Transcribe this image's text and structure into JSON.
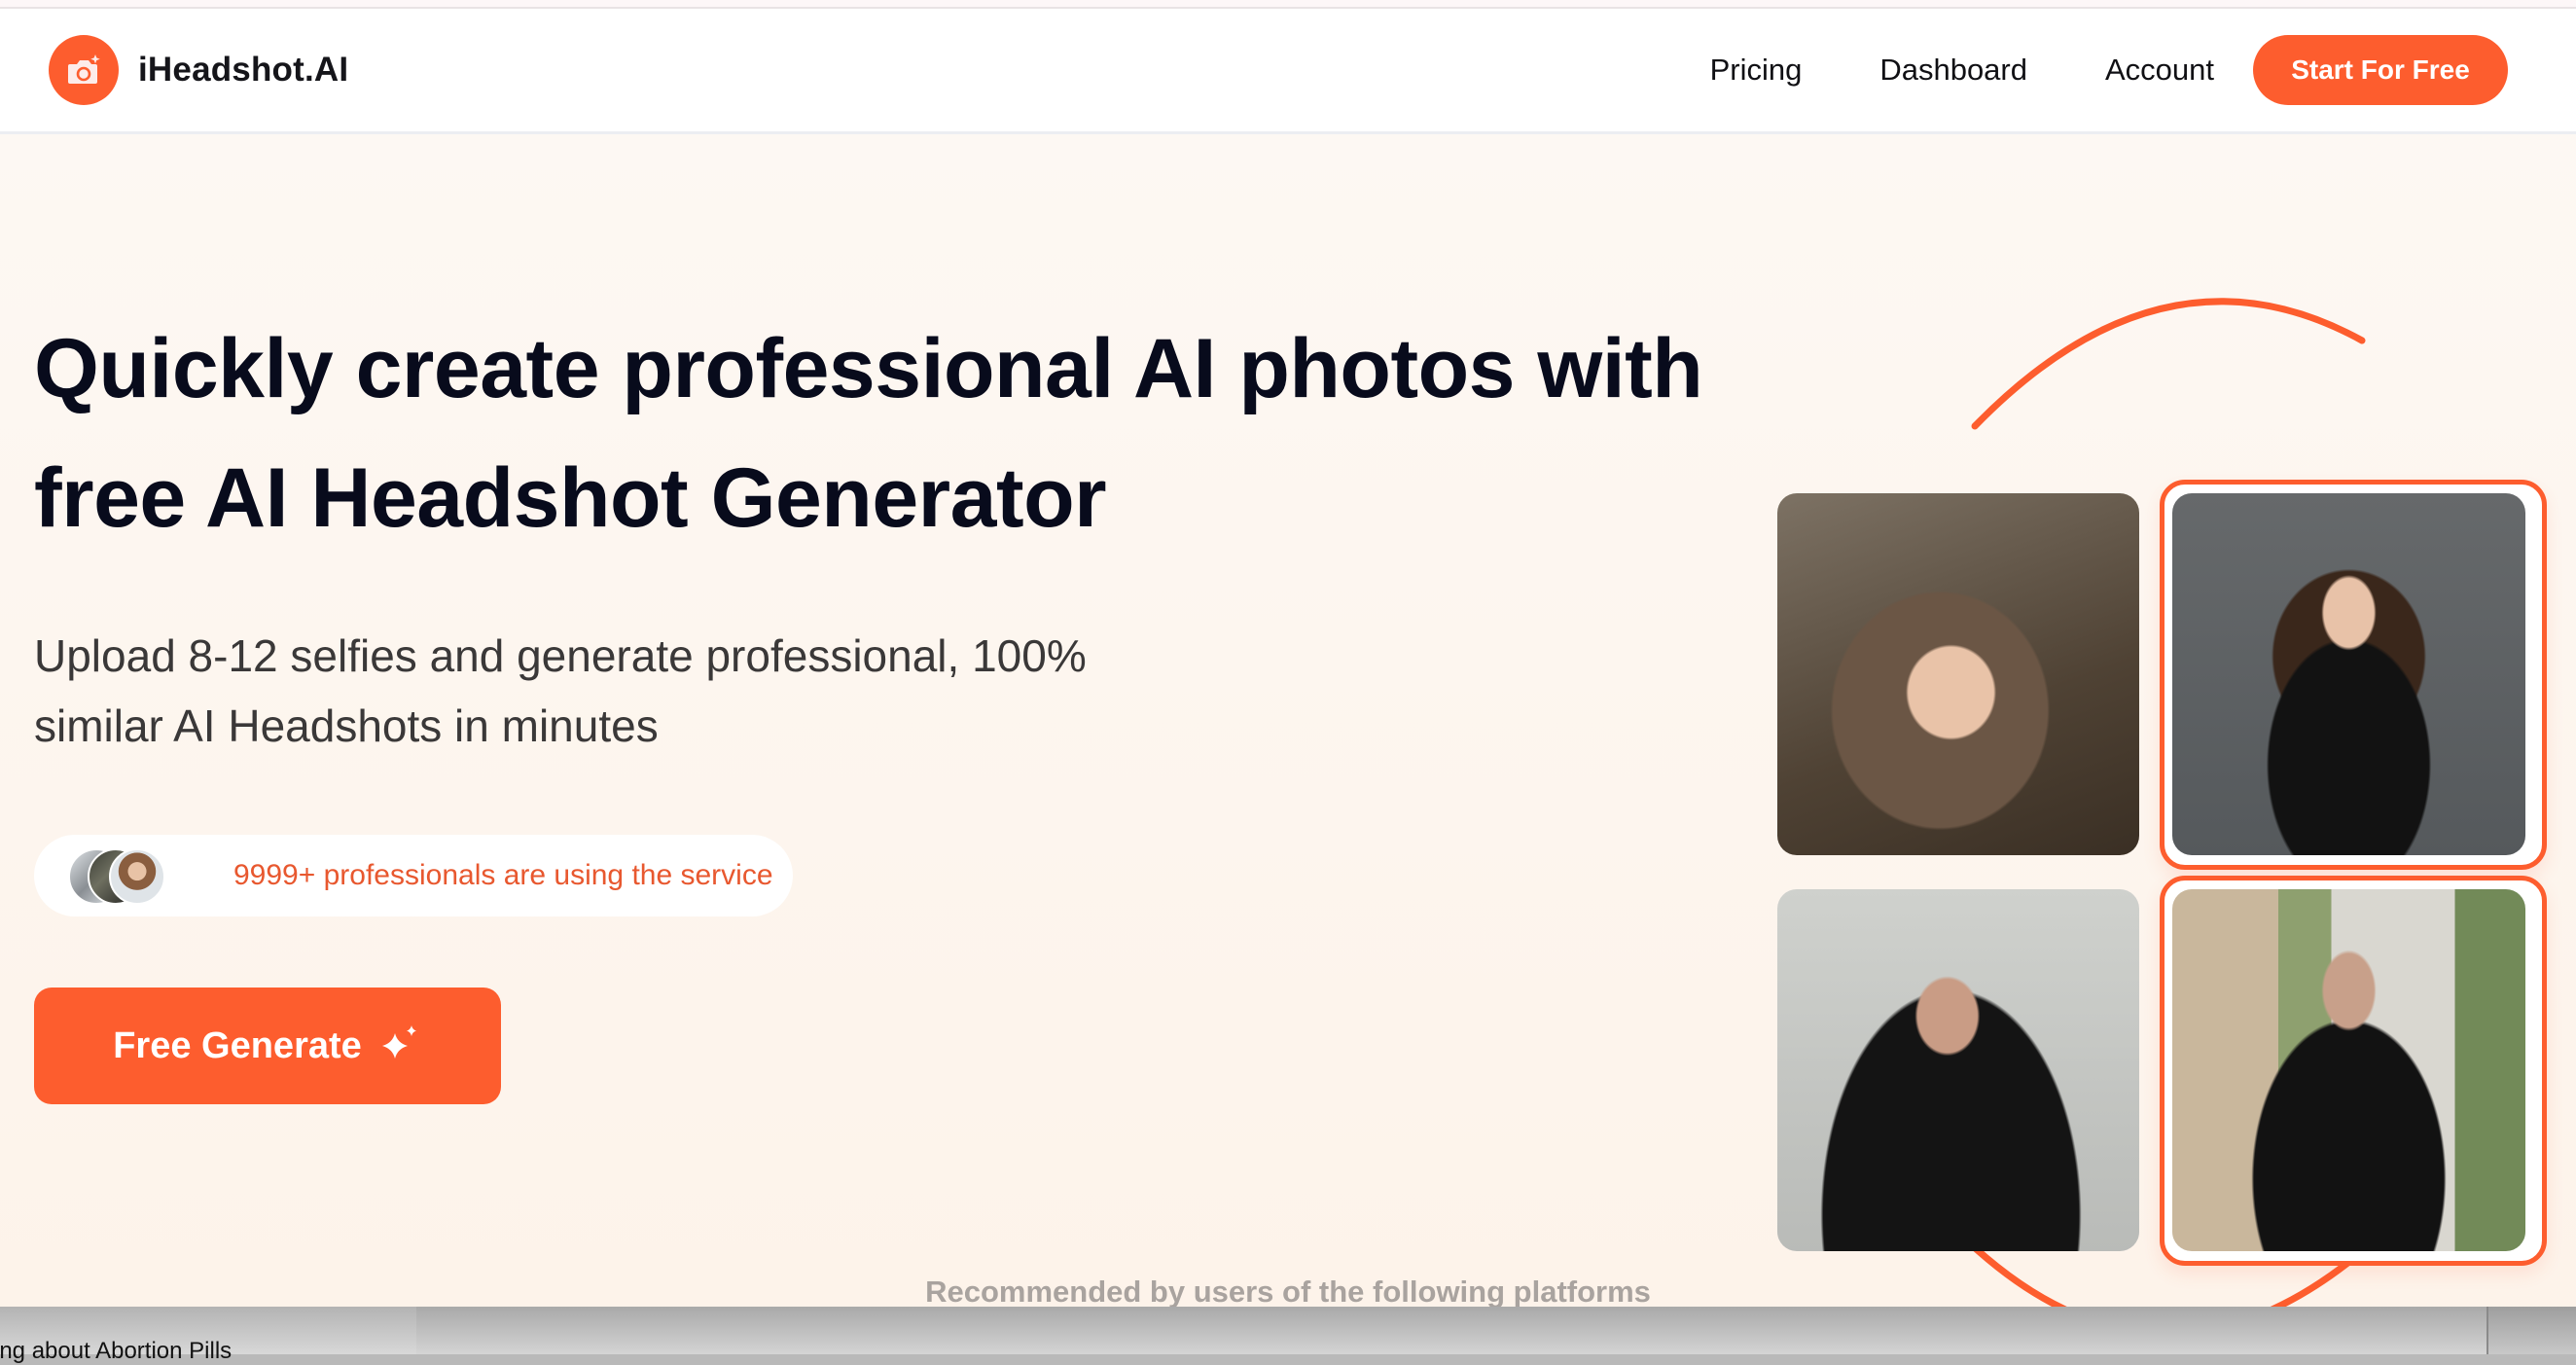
{
  "header": {
    "brand": "iHeadshot.AI",
    "brand_icon": "camera-sparkle-icon",
    "nav": [
      {
        "label": "Pricing"
      },
      {
        "label": "Dashboard"
      },
      {
        "label": "Account"
      }
    ],
    "cta_label": "Start For Free"
  },
  "hero": {
    "headline": "Quickly create professional AI photos with free AI Headshot Generator",
    "subtitle": "Upload 8-12 selfies and generate professional, 100% similar AI Headshots in minutes",
    "social_proof": "9999+ professionals are using the service",
    "generate_label": "Free Generate",
    "generate_icon": "sparkle-icon"
  },
  "gallery": {
    "items": [
      {
        "label": "selfie-woman-original"
      },
      {
        "label": "headshot-woman-generated",
        "highlighted": true
      },
      {
        "label": "selfie-man-original"
      },
      {
        "label": "headshot-man-generated",
        "highlighted": true
      }
    ]
  },
  "recommend_heading": "Recommended by users of the following platforms",
  "background_window": {
    "partial_text": "ing about Abortion Pills"
  },
  "colors": {
    "accent": "#fd5d2e",
    "hero_bg": "#fdf5ee",
    "headline": "#080b1c",
    "social_text": "#e8582f"
  }
}
